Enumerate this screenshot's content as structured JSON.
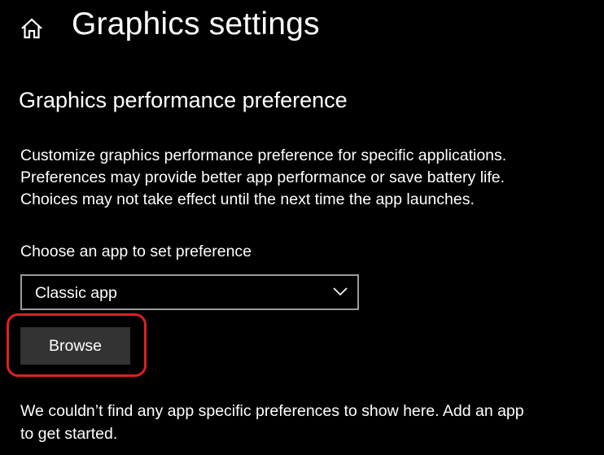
{
  "header": {
    "home_icon": "home-icon",
    "title": "Graphics settings"
  },
  "section": {
    "title": "Graphics performance preference",
    "description_lines": [
      "Customize graphics performance preference for specific applications.",
      "Preferences may provide better app performance or save battery life.",
      "Choices may not take effect until the next time the app launches."
    ]
  },
  "app_picker": {
    "label": "Choose an app to set preference",
    "selected_value": "Classic app",
    "chevron_icon": "chevron-down-icon"
  },
  "browse_button": {
    "label": "Browse",
    "highlight_color": "#e02020"
  },
  "empty_state": {
    "lines": [
      "We couldn’t find any app specific preferences to show here. Add an app",
      "to get started."
    ]
  },
  "colors": {
    "background": "#000000",
    "text": "#ffffff",
    "button_bg": "#333333",
    "dropdown_border": "#9a9a9a"
  }
}
